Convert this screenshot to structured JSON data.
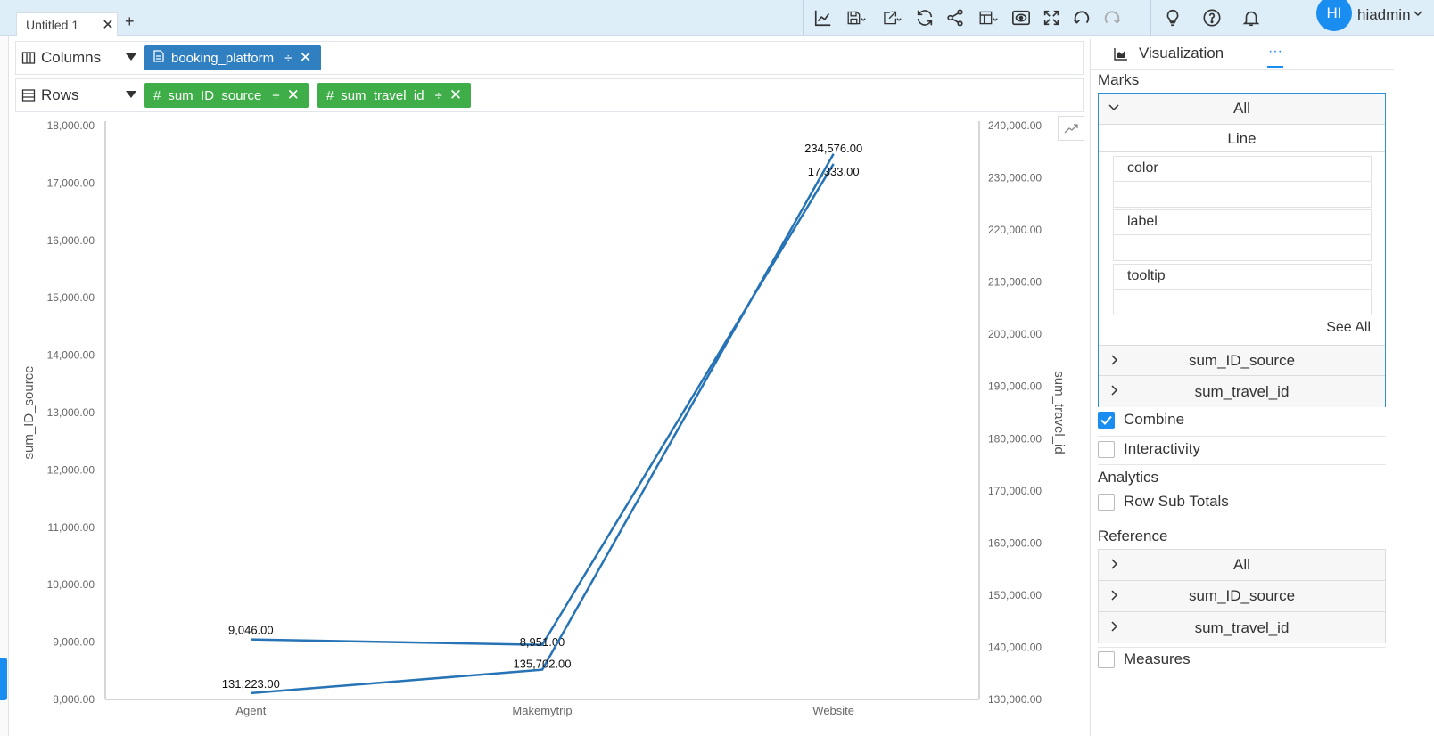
{
  "tabs": [
    {
      "label": "Untitled 1"
    }
  ],
  "user": {
    "initials": "HI",
    "name": "hiadmin"
  },
  "toolbar": {
    "icons": [
      "line-chart-icon",
      "save-icon",
      "export-icon",
      "refresh-icon",
      "share-icon",
      "layout-icon",
      "preview-icon",
      "fullscreen-icon",
      "undo-icon",
      "redo-icon",
      "lightbulb-icon",
      "help-icon",
      "bell-icon"
    ]
  },
  "shelves": {
    "columns": {
      "label": "Columns",
      "pills": [
        {
          "label": "booking_platform",
          "type": "dimension"
        }
      ]
    },
    "rows": {
      "label": "Rows",
      "pills": [
        {
          "label": "sum_ID_source",
          "type": "measure"
        },
        {
          "label": "sum_travel_id",
          "type": "measure"
        }
      ]
    }
  },
  "panel": {
    "tab_label": "Visualization",
    "more_label": "···",
    "marks_title": "Marks",
    "marks_all": "All",
    "mark_type": "Line",
    "props": [
      "color",
      "label",
      "tooltip"
    ],
    "see_all": "See All",
    "marks_measures": [
      "sum_ID_source",
      "sum_travel_id"
    ],
    "combine_label": "Combine",
    "interactivity_label": "Interactivity",
    "analytics_title": "Analytics",
    "row_sub_totals_label": "Row Sub Totals",
    "reference_title": "Reference",
    "reference_items": [
      "All",
      "sum_ID_source",
      "sum_travel_id"
    ],
    "measures_label": "Measures",
    "accent_color": "#1a8df0"
  },
  "chart_data": {
    "type": "line",
    "categories": [
      "Agent",
      "Makemytrip",
      "Website"
    ],
    "series": [
      {
        "name": "sum_ID_source",
        "axis": "left",
        "values": [
          9046,
          8951,
          17333
        ],
        "labels": [
          "9,046.00",
          "8,951.00",
          "17,333.00"
        ]
      },
      {
        "name": "sum_travel_id",
        "axis": "right",
        "values": [
          131223,
          135702,
          234576
        ],
        "labels": [
          "131,223.00",
          "135,702.00",
          "234,576.00"
        ]
      }
    ],
    "ylabel": "sum_ID_source",
    "y2label": "sum_travel_id",
    "ylim": [
      8000,
      18000
    ],
    "y2lim": [
      130000,
      240000
    ],
    "y_ticks": [
      "8,000.00",
      "9,000.00",
      "10,000.00",
      "11,000.00",
      "12,000.00",
      "13,000.00",
      "14,000.00",
      "15,000.00",
      "16,000.00",
      "17,000.00",
      "18,000.00"
    ],
    "y2_ticks": [
      "130,000.00",
      "140,000.00",
      "150,000.00",
      "160,000.00",
      "170,000.00",
      "180,000.00",
      "190,000.00",
      "200,000.00",
      "210,000.00",
      "220,000.00",
      "230,000.00",
      "240,000.00"
    ],
    "line_color": "#2673b5",
    "grid": false
  }
}
